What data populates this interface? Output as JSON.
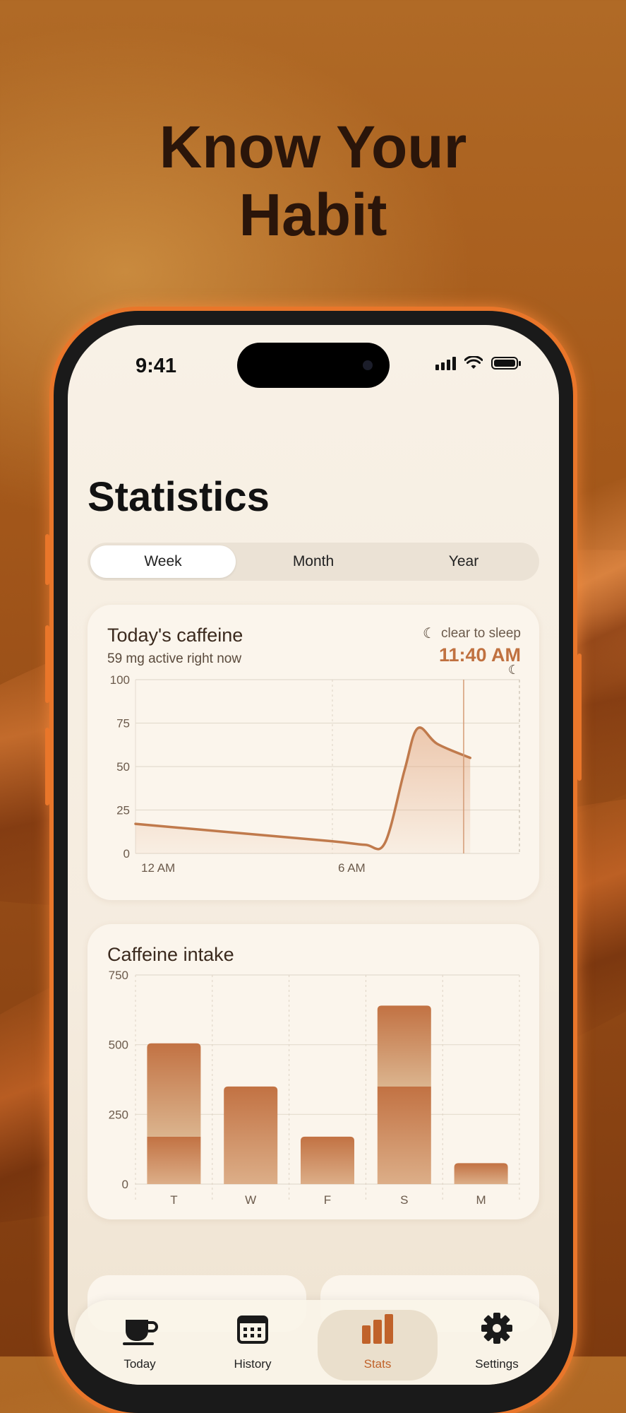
{
  "headline": {
    "line1": "Know Your",
    "line2": "Habit"
  },
  "status_bar": {
    "time": "9:41"
  },
  "screen": {
    "title": "Statistics",
    "segments": [
      {
        "label": "Week",
        "active": true
      },
      {
        "label": "Month",
        "active": false
      },
      {
        "label": "Year",
        "active": false
      }
    ],
    "caffeine_card": {
      "title": "Today's caffeine",
      "subtitle": "59 mg active right now",
      "sleep_label": "clear to sleep",
      "sleep_time": "11:40 AM",
      "y_ticks": [
        "100",
        "75",
        "50",
        "25",
        "0"
      ],
      "x_ticks": [
        "12 AM",
        "6 AM"
      ]
    },
    "intake_card": {
      "title": "Caffeine intake",
      "y_ticks": [
        "750",
        "500",
        "250",
        "0"
      ],
      "x_ticks": [
        "T",
        "W",
        "F",
        "S",
        "M"
      ]
    },
    "tabs": [
      {
        "label": "Today",
        "icon": "coffee-cup-icon"
      },
      {
        "label": "History",
        "icon": "calendar-icon"
      },
      {
        "label": "Stats",
        "icon": "bar-chart-icon",
        "active": true
      },
      {
        "label": "Settings",
        "icon": "gear-icon"
      }
    ]
  },
  "colors": {
    "accent": "#c0622a",
    "bar_top": "#d7a37a",
    "bar_bottom": "#c07140",
    "line": "#c07a4c"
  },
  "chart_data": [
    {
      "type": "area",
      "title": "Today's caffeine",
      "xlabel": "",
      "ylabel": "",
      "ylim": [
        0,
        100
      ],
      "x_ticks": [
        "12 AM",
        "6 AM"
      ],
      "x_hours": [
        0,
        3,
        6,
        7,
        7.6,
        8.2,
        8.6,
        9.2,
        10.2
      ],
      "values": [
        17,
        12,
        7,
        5,
        6,
        48,
        72,
        63,
        55
      ],
      "marker_hour": 10.0
    },
    {
      "type": "bar",
      "title": "Caffeine intake",
      "categories": [
        "T",
        "W",
        "F",
        "S",
        "M"
      ],
      "series": [
        {
          "values": [
            170,
            350,
            170,
            350,
            75
          ]
        },
        {
          "values": [
            335,
            0,
            0,
            290,
            0
          ]
        }
      ],
      "ylim": [
        0,
        750
      ],
      "stacked": true
    }
  ]
}
